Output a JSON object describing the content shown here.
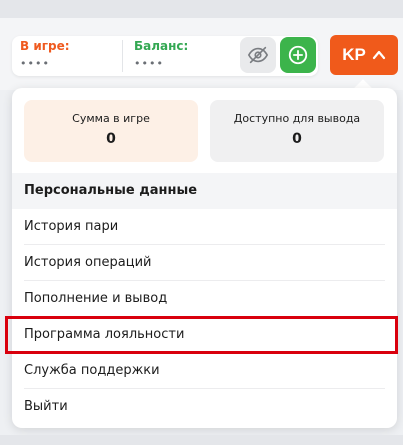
{
  "header": {
    "in_game_label": "В игре:",
    "in_game_value": "••••",
    "balance_label": "Баланс:",
    "balance_value": "••••",
    "avatar_initials": "KP",
    "accent_color": "#f05a1b",
    "eye_icon": "eye-slash-icon",
    "plus_icon": "plus-circle-icon"
  },
  "dropdown": {
    "sum_in_game_label": "Сумма в игре",
    "sum_in_game_value": "0",
    "available_label": "Доступно для вывода",
    "available_value": "0",
    "section_title": "Персональные данные",
    "items": [
      {
        "label": "История пари"
      },
      {
        "label": "История операций"
      },
      {
        "label": "Пополнение и вывод"
      },
      {
        "label": "Программа лояльности",
        "highlighted": true
      },
      {
        "label": "Служба поддержки"
      },
      {
        "label": "Выйти"
      }
    ]
  }
}
